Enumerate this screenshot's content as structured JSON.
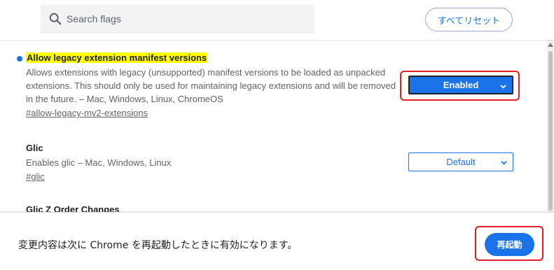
{
  "header": {
    "search_placeholder": "Search flags",
    "reset_all_label": "すべてリセット"
  },
  "flags": [
    {
      "title": "Allow legacy extension manifest versions",
      "description": "Allows extensions with legacy (unsupported) manifest versions to be loaded as unpacked extensions. This should only be used for maintaining legacy extensions and will be removed in the future. – Mac, Windows, Linux, ChromeOS",
      "anchor": "#allow-legacy-mv2-extensions",
      "selected_value": "Enabled",
      "modified": true,
      "title_highlighted": true
    },
    {
      "title": "Glic",
      "description": "Enables glic – Mac, Windows, Linux",
      "anchor": "#glic",
      "selected_value": "Default",
      "modified": false
    },
    {
      "title": "Glic Z Order Changes"
    }
  ],
  "footer": {
    "message": "変更内容は次に Chrome を再起動したときに有効になります。",
    "relaunch_label": "再起動"
  },
  "colors": {
    "accent": "#1a73e8",
    "highlight": "#ffff00",
    "annotation_red": "#e51c23"
  },
  "icons": {
    "search": "search-icon",
    "dropdown": "chevron-down-icon",
    "modified": "modified-dot-icon"
  }
}
